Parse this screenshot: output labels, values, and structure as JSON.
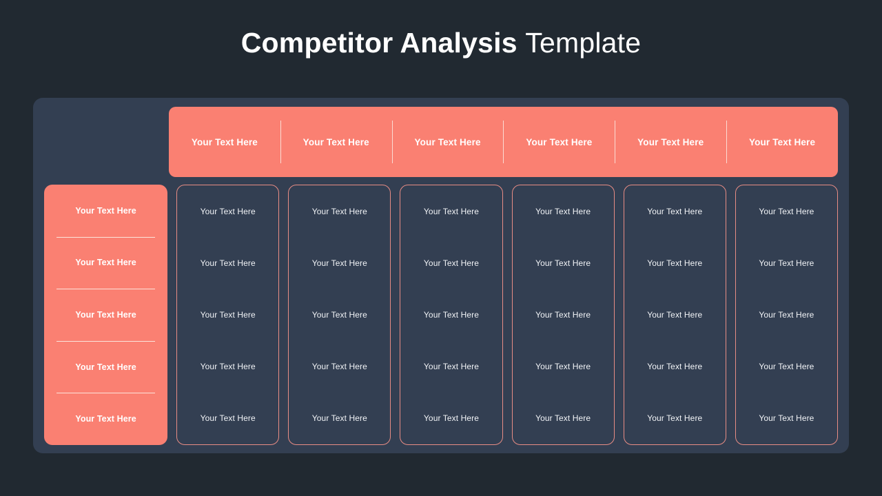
{
  "colors": {
    "page_background": "#212931",
    "panel_background": "#333F52",
    "accent_salmon": "#FA8072",
    "border_salmon": "#E98D85",
    "divider_cream": "#FCEAE2",
    "text_white": "#FFFFFF",
    "text_light": "#F2F4F7"
  },
  "title": {
    "bold_part": "Competitor Analysis",
    "light_part": "Template"
  },
  "header_row": {
    "cells": [
      {
        "label": "Your Text Here"
      },
      {
        "label": "Your Text Here"
      },
      {
        "label": "Your Text Here"
      },
      {
        "label": "Your Text Here"
      },
      {
        "label": "Your Text Here"
      },
      {
        "label": "Your Text Here"
      }
    ]
  },
  "columns": [
    {
      "style": "primary",
      "cells": [
        {
          "label": "Your Text Here"
        },
        {
          "label": "Your Text Here"
        },
        {
          "label": "Your Text Here"
        },
        {
          "label": "Your Text Here"
        },
        {
          "label": "Your Text Here"
        }
      ]
    },
    {
      "style": "plain",
      "cells": [
        {
          "label": "Your Text Here"
        },
        {
          "label": "Your Text Here"
        },
        {
          "label": "Your Text Here"
        },
        {
          "label": "Your Text Here"
        },
        {
          "label": "Your Text Here"
        }
      ]
    },
    {
      "style": "plain",
      "cells": [
        {
          "label": "Your Text Here"
        },
        {
          "label": "Your Text Here"
        },
        {
          "label": "Your Text Here"
        },
        {
          "label": "Your Text Here"
        },
        {
          "label": "Your Text Here"
        }
      ]
    },
    {
      "style": "plain",
      "cells": [
        {
          "label": "Your Text Here"
        },
        {
          "label": "Your Text Here"
        },
        {
          "label": "Your Text Here"
        },
        {
          "label": "Your Text Here"
        },
        {
          "label": "Your Text Here"
        }
      ]
    },
    {
      "style": "plain",
      "cells": [
        {
          "label": "Your Text Here"
        },
        {
          "label": "Your Text Here"
        },
        {
          "label": "Your Text Here"
        },
        {
          "label": "Your Text Here"
        },
        {
          "label": "Your Text Here"
        }
      ]
    },
    {
      "style": "plain",
      "cells": [
        {
          "label": "Your Text Here"
        },
        {
          "label": "Your Text Here"
        },
        {
          "label": "Your Text Here"
        },
        {
          "label": "Your Text Here"
        },
        {
          "label": "Your Text Here"
        }
      ]
    },
    {
      "style": "plain",
      "cells": [
        {
          "label": "Your Text Here"
        },
        {
          "label": "Your Text Here"
        },
        {
          "label": "Your Text Here"
        },
        {
          "label": "Your Text Here"
        },
        {
          "label": "Your Text Here"
        }
      ]
    }
  ]
}
